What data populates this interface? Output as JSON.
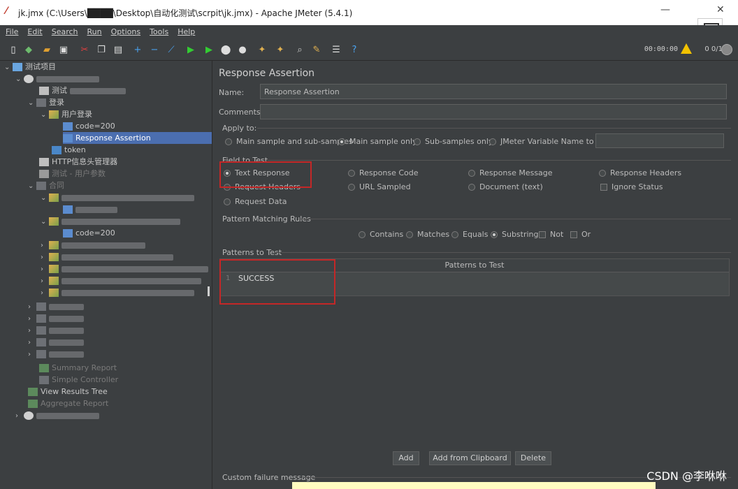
{
  "window": {
    "title": "jk.jmx (C:\\Users\\████\\Desktop\\自动化测试\\scrpit\\jk.jmx) - Apache JMeter (5.4.1)",
    "minimize": "—",
    "close": "✕"
  },
  "menu": [
    "File",
    "Edit",
    "Search",
    "Run",
    "Options",
    "Tools",
    "Help"
  ],
  "toolbar": {
    "timer": "00:00:00",
    "counter": "0 0/1",
    "colors": {
      "warning": "#f2c200",
      "run": "#33cc33"
    }
  },
  "tree": {
    "root": "测试项目",
    "nodes": [
      {
        "label": "测试",
        "indent": 1
      },
      {
        "label": "登录",
        "indent": 2
      },
      {
        "label": "用户登录",
        "indent": 3
      },
      {
        "label": "code=200",
        "indent": 4
      },
      {
        "label": "Response Assertion",
        "indent": 4
      },
      {
        "label": "token",
        "indent": 3
      },
      {
        "label": "HTTP信息头管理器",
        "indent": 2
      },
      {
        "label": "测试 - 用户参数",
        "indent": 2
      },
      {
        "label": "合同",
        "indent": 2
      },
      {
        "label": "code=200",
        "indent": 4
      },
      {
        "label": "code=200",
        "indent": 4
      },
      {
        "label": "Summary Report",
        "indent": 2
      },
      {
        "label": "Simple Controller",
        "indent": 2
      },
      {
        "label": "View Results Tree",
        "indent": 1
      },
      {
        "label": "Aggregate Report",
        "indent": 1
      }
    ]
  },
  "panel": {
    "heading": "Response Assertion",
    "name_label": "Name:",
    "name_value": "Response Assertion",
    "comments_label": "Comments:",
    "comments_value": "",
    "apply_to": {
      "label": "Apply to:",
      "options": [
        "Main sample and sub-samples",
        "Main sample only",
        "Sub-samples only",
        "JMeter Variable Name to use"
      ],
      "selected": "Main sample only"
    },
    "field_to_test": {
      "label": "Field to Test",
      "options": [
        "Text Response",
        "Response Code",
        "Response Message",
        "Response Headers",
        "Request Headers",
        "URL Sampled",
        "Document (text)",
        "Ignore Status",
        "Request Data"
      ],
      "selected": "Text Response"
    },
    "pattern_rules": {
      "label": "Pattern Matching Rules",
      "options": [
        "Contains",
        "Matches",
        "Equals",
        "Substring",
        "Not",
        "Or"
      ],
      "selected": "Substring"
    },
    "patterns": {
      "label": "Patterns to Test",
      "column": "Patterns to Test",
      "rows": [
        {
          "num": "1",
          "value": "SUCCESS"
        }
      ]
    },
    "buttons": {
      "add": "Add",
      "add_clipboard": "Add from Clipboard",
      "delete": "Delete"
    },
    "custom_failure_label": "Custom failure message"
  },
  "watermark": "CSDN @李咻咻"
}
